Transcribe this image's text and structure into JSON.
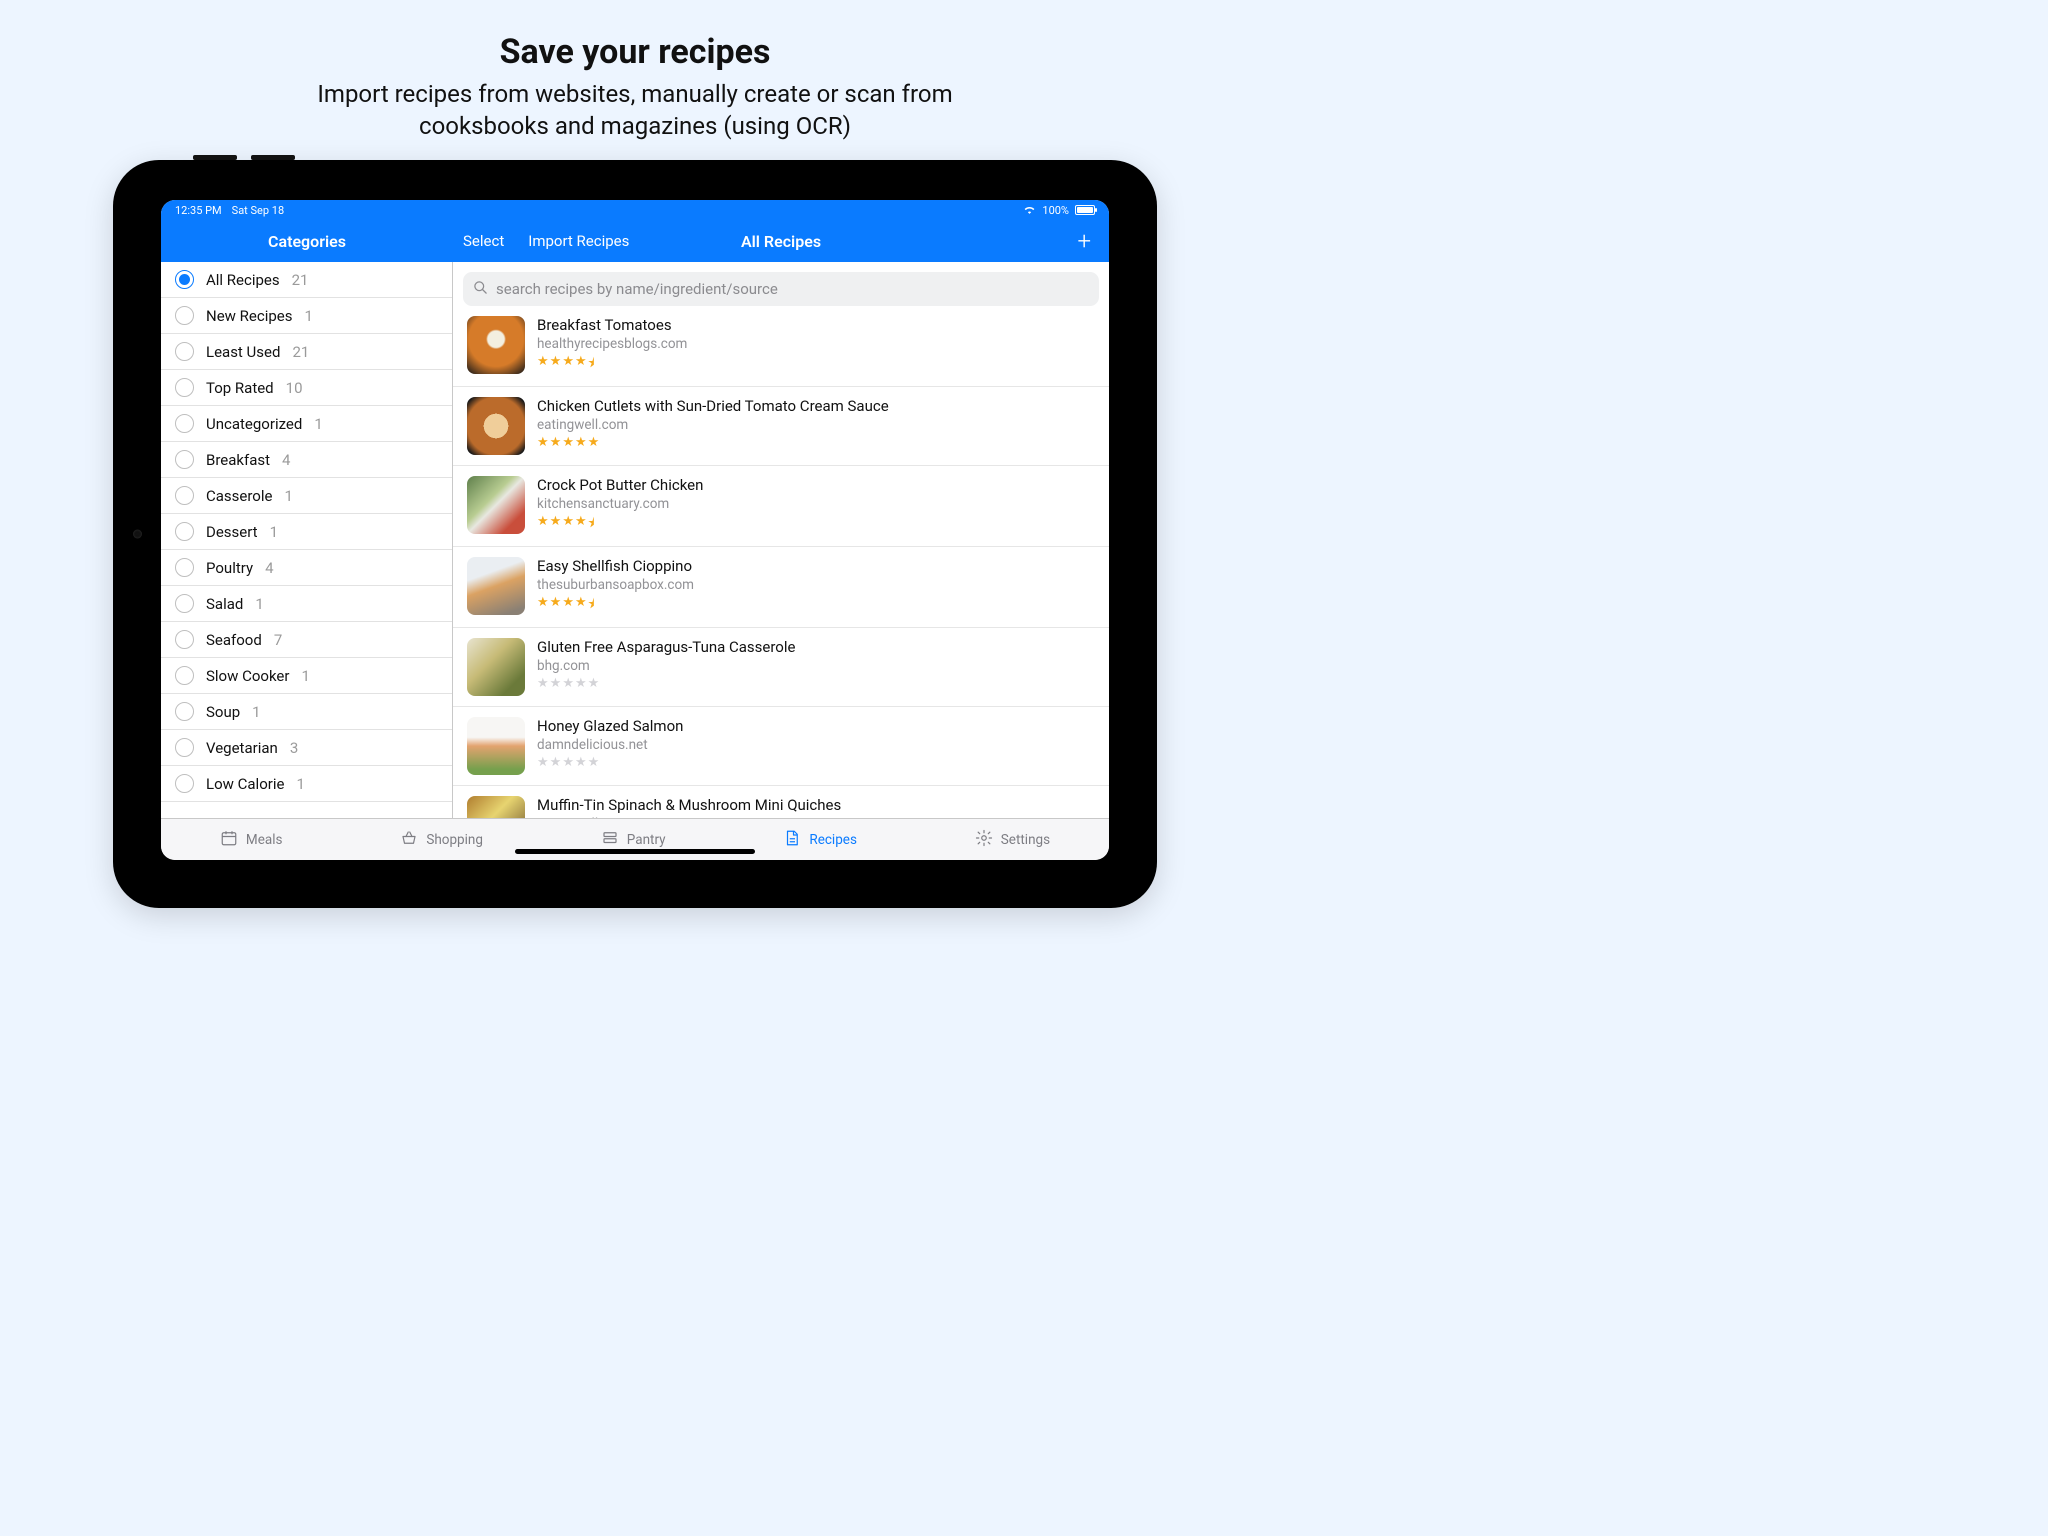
{
  "promo": {
    "title": "Save your recipes",
    "subtitle_line1": "Import recipes from websites, manually create or scan from",
    "subtitle_line2": "cooksbooks and magazines (using OCR)"
  },
  "status": {
    "time": "12:35 PM",
    "date": "Sat Sep 18",
    "battery_text": "100%"
  },
  "nav": {
    "categories_title": "Categories",
    "select": "Select",
    "import": "Import Recipes",
    "main_title": "All Recipes",
    "add_symbol": "+"
  },
  "search": {
    "placeholder": "search recipes by name/ingredient/source"
  },
  "categories": [
    {
      "label": "All Recipes",
      "count": "21",
      "selected": true
    },
    {
      "label": "New Recipes",
      "count": "1",
      "selected": false
    },
    {
      "label": "Least Used",
      "count": "21",
      "selected": false
    },
    {
      "label": "Top Rated",
      "count": "10",
      "selected": false
    },
    {
      "label": "Uncategorized",
      "count": "1",
      "selected": false
    },
    {
      "label": "Breakfast",
      "count": "4",
      "selected": false
    },
    {
      "label": "Casserole",
      "count": "1",
      "selected": false
    },
    {
      "label": "Dessert",
      "count": "1",
      "selected": false
    },
    {
      "label": "Poultry",
      "count": "4",
      "selected": false
    },
    {
      "label": "Salad",
      "count": "1",
      "selected": false
    },
    {
      "label": "Seafood",
      "count": "7",
      "selected": false
    },
    {
      "label": "Slow Cooker",
      "count": "1",
      "selected": false
    },
    {
      "label": "Soup",
      "count": "1",
      "selected": false
    },
    {
      "label": "Vegetarian",
      "count": "3",
      "selected": false
    },
    {
      "label": "Low Calorie",
      "count": "1",
      "selected": false
    }
  ],
  "recipes": [
    {
      "title": "Breakfast Tomatoes",
      "source": "healthyrecipesblogs.com",
      "rating": 4.5
    },
    {
      "title": "Chicken Cutlets with Sun-Dried Tomato Cream Sauce",
      "source": "eatingwell.com",
      "rating": 5
    },
    {
      "title": "Crock Pot Butter Chicken",
      "source": "kitchensanctuary.com",
      "rating": 4.5
    },
    {
      "title": "Easy Shellfish Cioppino",
      "source": "thesuburbansoapbox.com",
      "rating": 4.5
    },
    {
      "title": "Gluten Free Asparagus-Tuna Casserole",
      "source": "bhg.com",
      "rating": 0
    },
    {
      "title": "Honey Glazed Salmon",
      "source": "damndelicious.net",
      "rating": 0
    },
    {
      "title": "Muffin-Tin Spinach & Mushroom Mini Quiches",
      "source": "eatingwell.com",
      "rating": 0
    }
  ],
  "tabs": {
    "meals": "Meals",
    "shopping": "Shopping",
    "pantry": "Pantry",
    "recipes": "Recipes",
    "settings": "Settings"
  }
}
